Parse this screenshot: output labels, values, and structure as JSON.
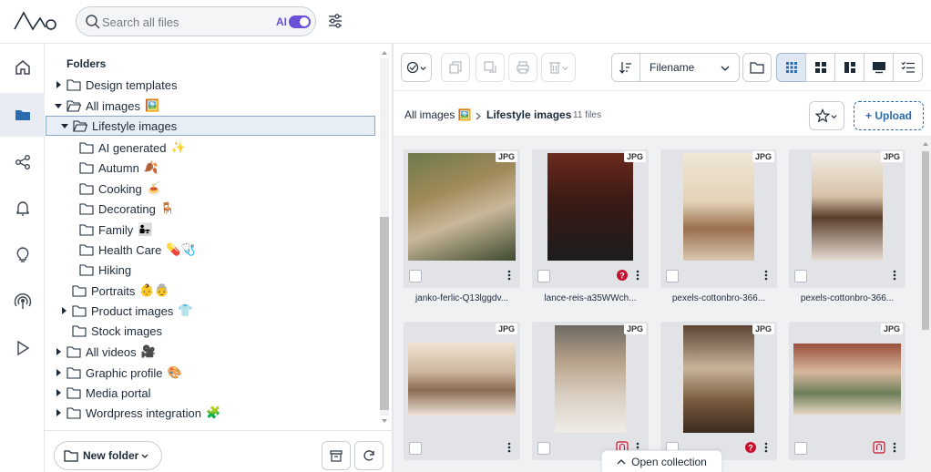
{
  "search": {
    "placeholder": "Search all files",
    "ai_label": "AI"
  },
  "tree": {
    "title": "Folders",
    "nodes": [
      {
        "label": "Design templates",
        "emoji": ""
      },
      {
        "label": "All images",
        "emoji": "🖼️"
      },
      {
        "label": "Lifestyle images",
        "emoji": ""
      },
      {
        "label": "AI generated",
        "emoji": "✨"
      },
      {
        "label": "Autumn",
        "emoji": "🍂"
      },
      {
        "label": "Cooking",
        "emoji": "🍝"
      },
      {
        "label": "Decorating",
        "emoji": "🪑"
      },
      {
        "label": "Family",
        "emoji": "👨‍👧"
      },
      {
        "label": "Health Care",
        "emoji": "💊🩺"
      },
      {
        "label": "Hiking",
        "emoji": ""
      },
      {
        "label": "Portraits",
        "emoji": "👶👵"
      },
      {
        "label": "Product images",
        "emoji": "👕"
      },
      {
        "label": "Stock images",
        "emoji": ""
      },
      {
        "label": "All videos",
        "emoji": "🎥"
      },
      {
        "label": "Graphic profile",
        "emoji": "🎨"
      },
      {
        "label": "Media portal",
        "emoji": ""
      },
      {
        "label": "Wordpress integration",
        "emoji": "🧩"
      }
    ]
  },
  "footer": {
    "new_folder": "New folder"
  },
  "toolbar": {
    "sort_label": "Filename"
  },
  "breadcrumb": {
    "root": "All images 🖼️",
    "current": "Lifestyle images",
    "count": "11 files"
  },
  "upload_label": "+ Upload",
  "files": [
    {
      "type": "JPG",
      "name": "janko-ferlic-Q13lggdv..."
    },
    {
      "type": "JPG",
      "name": "lance-reis-a35WWch..."
    },
    {
      "type": "JPG",
      "name": "pexels-cottonbro-366..."
    },
    {
      "type": "JPG",
      "name": "pexels-cottonbro-366..."
    },
    {
      "type": "JPG",
      "name": ""
    },
    {
      "type": "JPG",
      "name": ""
    },
    {
      "type": "JPG",
      "name": ""
    },
    {
      "type": "JPG",
      "name": ""
    }
  ],
  "open_collection": "Open collection",
  "colors": {
    "accent": "#6c4fd8",
    "link": "#2b6cb0",
    "selected_bg": "#e8eef6"
  }
}
